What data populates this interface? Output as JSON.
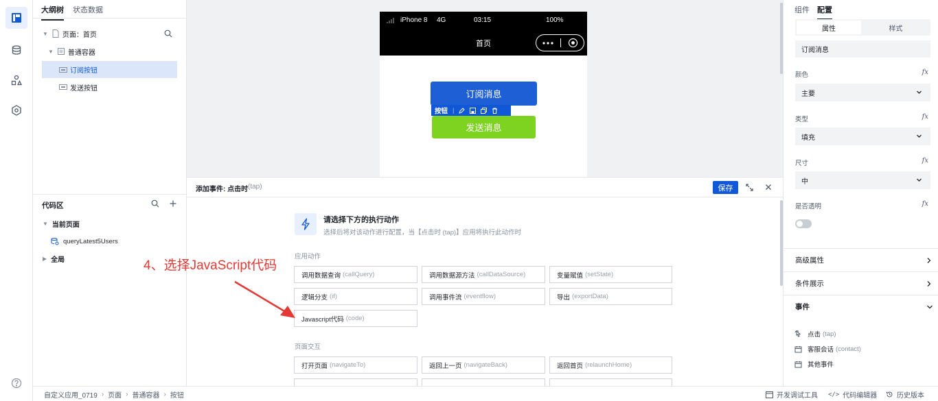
{
  "outline": {
    "tabs": [
      "大纲树",
      "状态数据"
    ],
    "page_node": "页面：首页",
    "container_node": "普通容器",
    "nodes": [
      "订阅按钮",
      "发送按钮"
    ]
  },
  "code_area": {
    "title": "代码区",
    "current_page": "当前页面",
    "query": "queryLatest5Users",
    "global": "全局"
  },
  "phone": {
    "device": "iPhone 8",
    "network": "4G",
    "time": "03:15",
    "battery": "100%",
    "page_title": "首页",
    "buttons": [
      "订阅消息",
      "发送消息"
    ],
    "selection_label": "按钮"
  },
  "event_panel": {
    "title": "添加事件: 点击时",
    "title_en": "(tap)",
    "save": "保存",
    "prompt_title": "请选择下方的执行动作",
    "prompt_desc": "选择后将对该动作进行配置，当【点击时 (tap)】应用将执行此动作时",
    "section_app": "应用动作",
    "section_page": "页面交互",
    "app_actions": [
      {
        "zh": "调用数据查询",
        "en": "(callQuery)"
      },
      {
        "zh": "调用数据源方法",
        "en": "(callDataSource)"
      },
      {
        "zh": "变量赋值",
        "en": "(setState)"
      },
      {
        "zh": "逻辑分支",
        "en": "(if)"
      },
      {
        "zh": "调用事件流",
        "en": "(eventflow)"
      },
      {
        "zh": "导出",
        "en": "(exportData)"
      },
      {
        "zh": "Javascript代码",
        "en": "(code)"
      }
    ],
    "page_actions": [
      {
        "zh": "打开页面",
        "en": "(navigateTo)"
      },
      {
        "zh": "返回上一页",
        "en": "(navigateBack)"
      },
      {
        "zh": "返回首页",
        "en": "(relaunchHome)"
      }
    ]
  },
  "annotation": {
    "text": "4、选择JavaScript代码",
    "color": "#e53935"
  },
  "right_panel": {
    "tabs": [
      "组件",
      "配置"
    ],
    "segments": [
      "属性",
      "样式"
    ],
    "component_name": "订阅消息",
    "fields": [
      {
        "label": "颜色",
        "value": "主要"
      },
      {
        "label": "类型",
        "value": "填充"
      },
      {
        "label": "尺寸",
        "value": "中"
      }
    ],
    "transparent_label": "是否透明",
    "transparent_on": false,
    "fx": "fx",
    "sections": [
      "高级属性",
      "条件展示",
      "事件"
    ],
    "events": [
      {
        "zh": "点击",
        "en": "(tap)"
      },
      {
        "zh": "客服会话",
        "en": "(contact)"
      },
      {
        "zh": "其他事件",
        "en": ""
      }
    ]
  },
  "status_bar": {
    "breadcrumb": [
      "自定义应用_0719",
      "页面",
      "普通容器",
      "按钮"
    ],
    "tools": [
      "开发调试工具",
      "代码编辑器",
      "历史版本"
    ]
  },
  "colors": {
    "primary": "#1f5fd6",
    "green": "#7ed321",
    "accent_blue": "#1158d8"
  }
}
